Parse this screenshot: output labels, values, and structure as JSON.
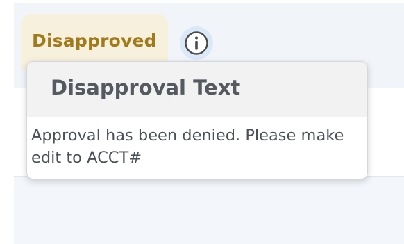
{
  "status": {
    "label": "Disapproved",
    "color": "#a07a1b",
    "background": "#f6f0dc"
  },
  "info_button": {
    "icon": "info-icon"
  },
  "tooltip": {
    "title": "Disapproval Text",
    "body": "Approval has been denied. Please make edit to ACCT#"
  }
}
